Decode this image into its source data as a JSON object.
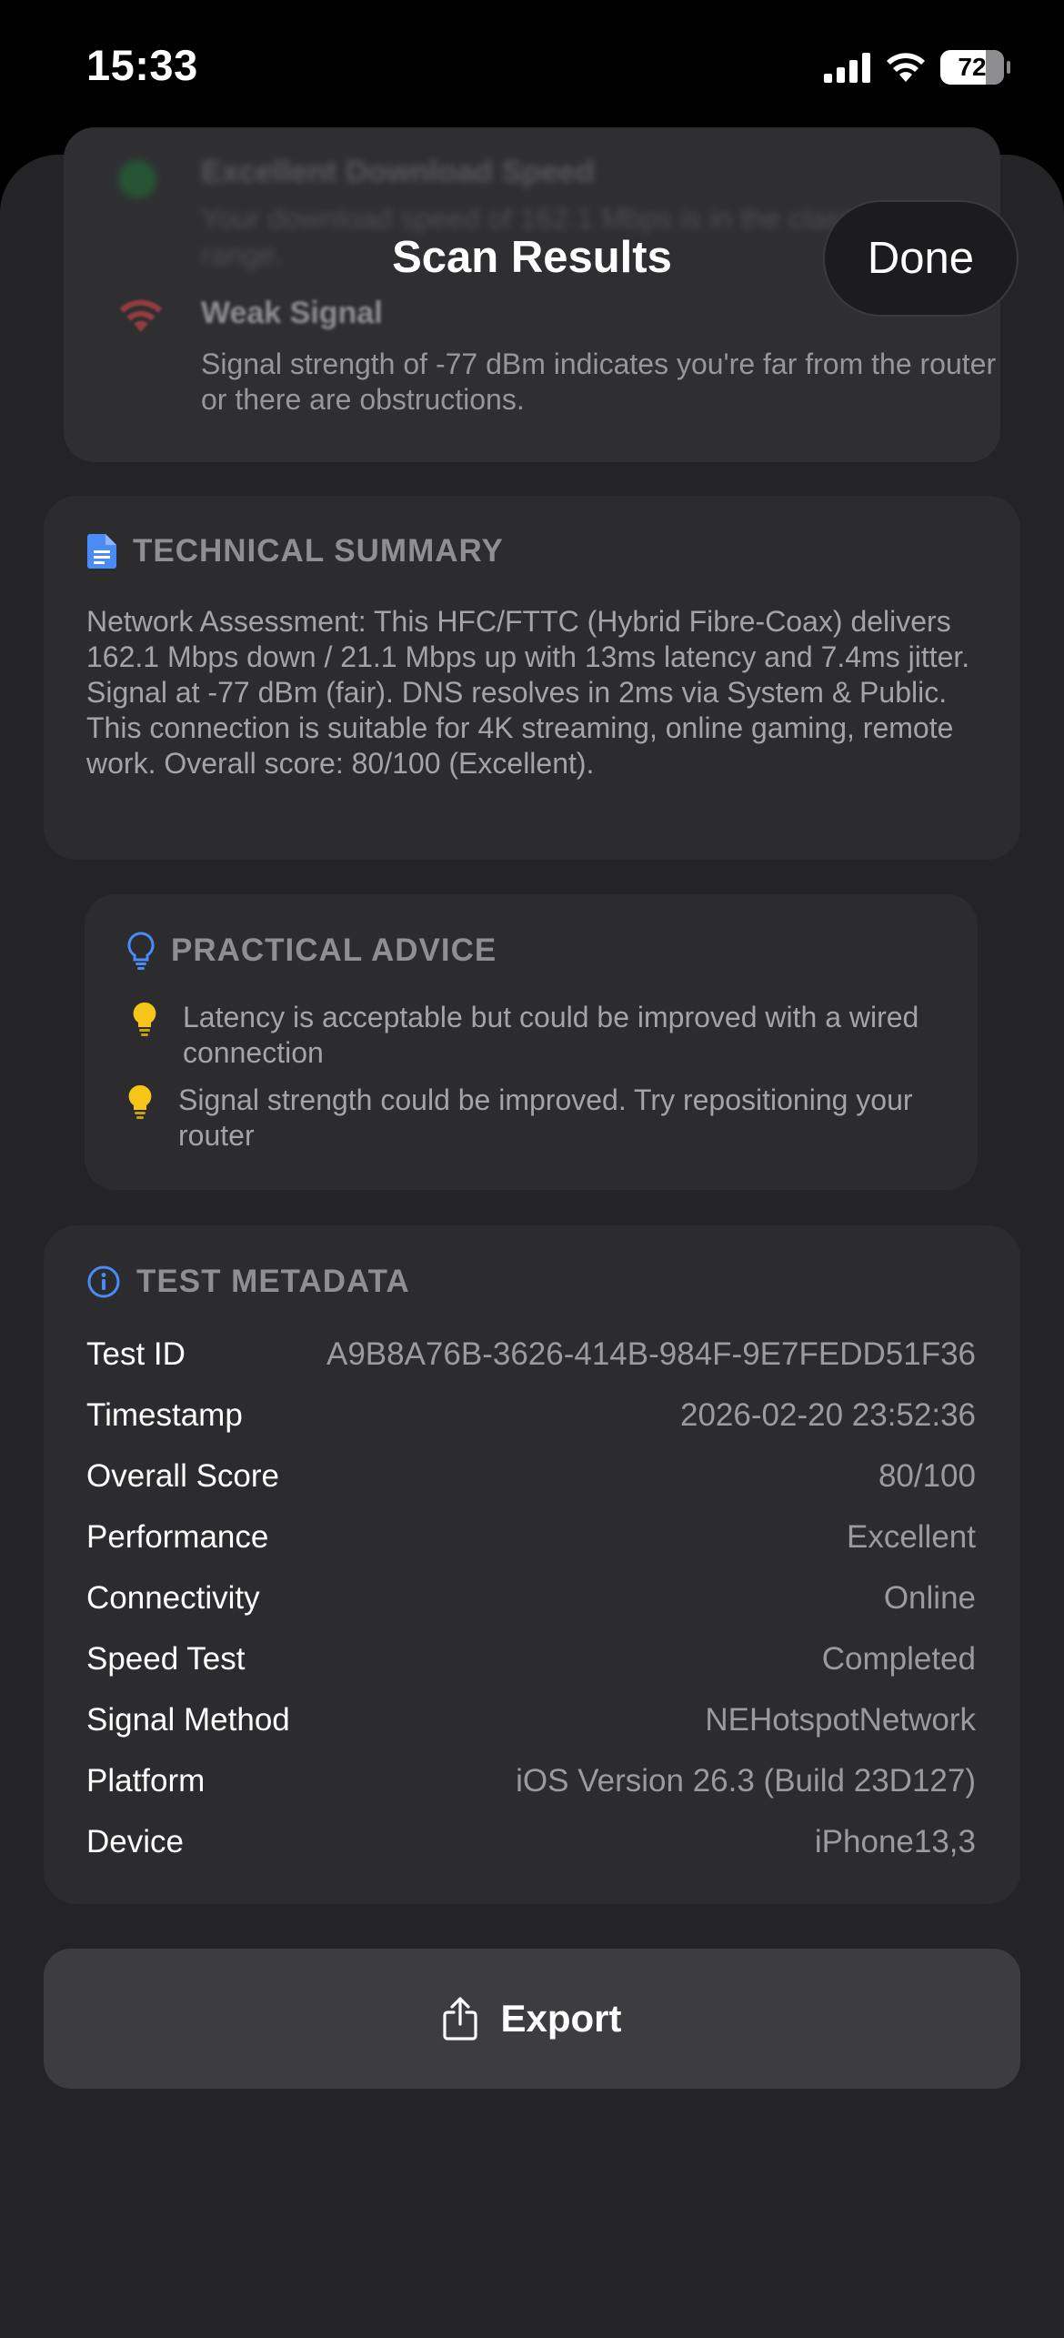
{
  "status_bar": {
    "time": "15:33",
    "battery": "72"
  },
  "header": {
    "title": "Scan Results",
    "done_label": "Done"
  },
  "background_insights": {
    "item1_title": "Excellent Download Speed",
    "item1_desc": "Your download speed of 162.1 Mbps is in the class range.",
    "item2_title": "Weak Signal",
    "item2_desc": "Signal strength of -77 dBm indicates you're far from the router or there are obstructions."
  },
  "technical_summary": {
    "title": "TECHNICAL SUMMARY",
    "body": "Network Assessment: This HFC/FTTC (Hybrid Fibre-Coax) delivers 162.1 Mbps down / 21.1 Mbps up with 13ms latency and 7.4ms jitter. Signal at -77 dBm (fair). DNS resolves in 2ms via System & Public. This connection is suitable for 4K streaming, online gaming, remote work. Overall score: 80/100 (Excellent)."
  },
  "practical_advice": {
    "title": "PRACTICAL ADVICE",
    "items": [
      "Latency is acceptable but could be improved with a wired connection",
      "Signal strength could be improved. Try repositioning your router"
    ]
  },
  "test_metadata": {
    "title": "TEST METADATA",
    "rows": [
      {
        "key": "Test ID",
        "value": "A9B8A76B-3626-414B-984F-9E7FEDD51F36"
      },
      {
        "key": "Timestamp",
        "value": "2026-02-20 23:52:36"
      },
      {
        "key": "Overall Score",
        "value": "80/100"
      },
      {
        "key": "Performance",
        "value": "Excellent"
      },
      {
        "key": "Connectivity",
        "value": "Online"
      },
      {
        "key": "Speed Test",
        "value": "Completed"
      },
      {
        "key": "Signal Method",
        "value": "NEHotspotNetwork"
      },
      {
        "key": "Platform",
        "value": "iOS Version 26.3 (Build 23D127)"
      },
      {
        "key": "Device",
        "value": "iPhone13,3"
      }
    ]
  },
  "export": {
    "label": "Export"
  },
  "colors": {
    "accent_blue": "#4a8cf7",
    "warning_red": "#e5484d",
    "bulb_yellow": "#f5c518"
  },
  "icons": {
    "summary": "document-icon",
    "advice": "lightbulb-icon",
    "advice_item": "lightbulb-filled-icon",
    "metadata": "info-icon",
    "export": "share-icon",
    "weak_signal": "wifi-icon",
    "status_bar": [
      "cellular-signal-icon",
      "wifi-icon",
      "battery-icon"
    ]
  }
}
